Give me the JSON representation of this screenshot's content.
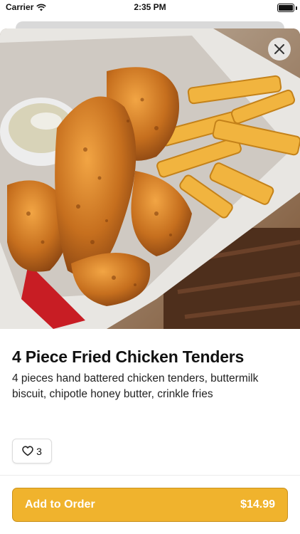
{
  "status_bar": {
    "carrier": "Carrier",
    "time": "2:35 PM"
  },
  "item": {
    "image_description_icon": "fried-chicken-tenders-photo",
    "title": "4 Piece Fried Chicken Tenders",
    "description": "4 pieces hand battered chicken tenders, buttermilk biscuit, chipotle honey butter, crinkle fries",
    "like_count": "3"
  },
  "order_button": {
    "label": "Add to Order",
    "price": "$14.99"
  },
  "colors": {
    "accent": "#f0b32d",
    "accent_border": "#c9911b"
  }
}
